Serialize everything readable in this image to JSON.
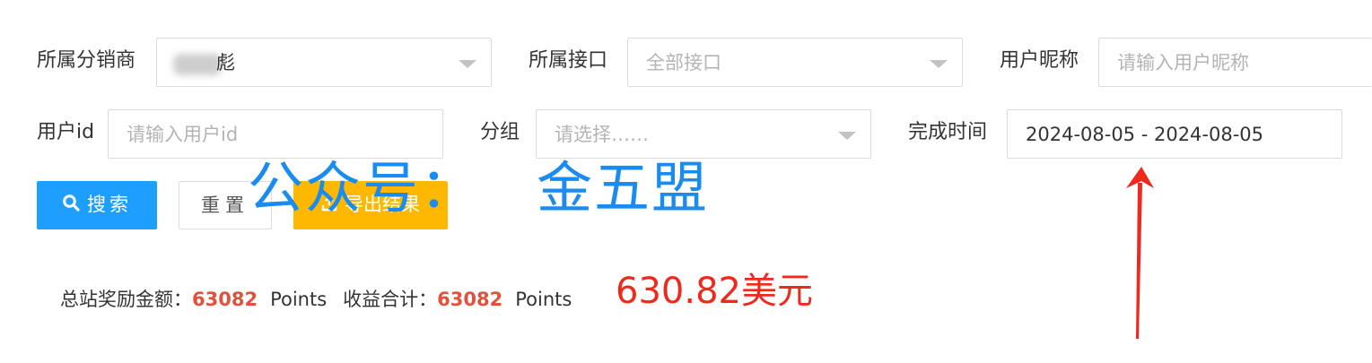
{
  "filters": {
    "distributor": {
      "label": "所属分销商",
      "value": "彪",
      "blurred": true
    },
    "interface": {
      "label": "所属接口",
      "placeholder": "全部接口"
    },
    "nickname": {
      "label": "用户昵称",
      "placeholder": "请输入用户昵称"
    },
    "user_id": {
      "label": "用户id",
      "placeholder": "请输入用户id"
    },
    "group": {
      "label": "分组",
      "placeholder": "请选择……"
    },
    "finish_time": {
      "label": "完成时间",
      "value": "2024-08-05 - 2024-08-05"
    }
  },
  "buttons": {
    "search": "搜索",
    "reset": "重置",
    "export": "导出结果"
  },
  "watermark": {
    "prefix": "公众号：",
    "name": "金五盟"
  },
  "summary": {
    "site_reward_label": "总站奖励金额：",
    "site_reward_value": "63082",
    "site_reward_unit": "Points",
    "income_total_label": "收益合计：",
    "income_total_value": "63082",
    "income_total_unit": "Points",
    "usd_amount": "630.82美元"
  },
  "colors": {
    "primary": "#1e9fff",
    "warning": "#ffb800",
    "amount": "#e0523b",
    "annotation_red": "#f0291c",
    "watermark_blue": "#1a8cf0"
  },
  "icons": {
    "search": "search-icon",
    "export": "export-icon",
    "dropdown": "chevron-down-icon",
    "annotation": "arrow-up-icon"
  }
}
